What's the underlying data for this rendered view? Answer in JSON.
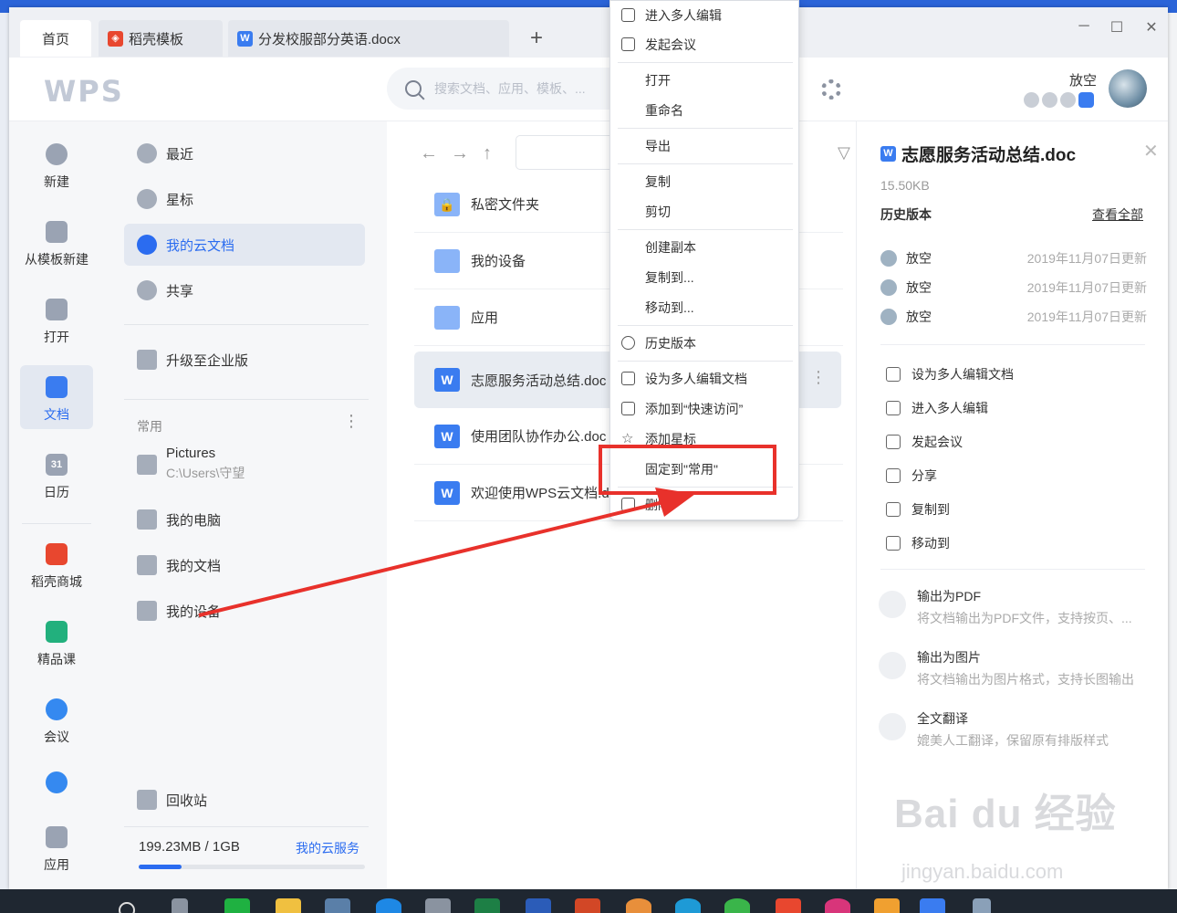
{
  "tabs": {
    "home": "首页",
    "template": "稻壳模板",
    "doc": "分发校服部分英语.docx",
    "add": "+"
  },
  "window": {
    "min": "─",
    "max": "☐",
    "close": "✕"
  },
  "header": {
    "logo": "WPS",
    "search_placeholder": "搜索文档、应用、模板、...",
    "user_name": "放空"
  },
  "rail": {
    "items": [
      {
        "label": "新建"
      },
      {
        "label": "从模板新建"
      },
      {
        "label": "打开"
      },
      {
        "label": "文档"
      },
      {
        "label": "日历"
      },
      {
        "label": "稻壳商城"
      },
      {
        "label": "精品课"
      },
      {
        "label": "会议"
      },
      {
        "label": "应用"
      }
    ],
    "calendar_day": "31"
  },
  "nav": {
    "recent": "最近",
    "star": "星标",
    "cloud": "我的云文档",
    "share": "共享",
    "upgrade": "升级至企业版",
    "common_head": "常用",
    "more": "⋮",
    "pictures_title": "Pictures",
    "pictures_path": "C:\\Users\\守望",
    "my_pc": "我的电脑",
    "my_docs": "我的文档",
    "my_device": "我的设备",
    "recycle": "回收站",
    "storage": "199.23MB / 1GB",
    "storage_link": "我的云服务",
    "storage_used": 0.19
  },
  "files": {
    "rows": [
      {
        "name": "私密文件夹"
      },
      {
        "name": "我的设备"
      },
      {
        "name": "应用"
      },
      {
        "name": "志愿服务活动总结.doc"
      },
      {
        "name": "使用团队协作办公.doc"
      },
      {
        "name": "欢迎使用WPS云文档.d"
      }
    ],
    "row_more": "⋮"
  },
  "menu": {
    "items": [
      "进入多人编辑",
      "发起会议",
      "打开",
      "重命名",
      "导出",
      "复制",
      "剪切",
      "创建副本",
      "复制到...",
      "移动到...",
      "历史版本",
      "设为多人编辑文档",
      "添加到“快速访问”",
      "添加星标",
      "固定到\"常用\"",
      "删除"
    ]
  },
  "detail": {
    "title": "志愿服务活动总结.doc",
    "size": "15.50KB",
    "history_head": "历史版本",
    "view_all": "查看全部",
    "history": [
      {
        "user": "放空",
        "date": "2019年11月07日更新"
      },
      {
        "user": "放空",
        "date": "2019年11月07日更新"
      },
      {
        "user": "放空",
        "date": "2019年11月07日更新"
      }
    ],
    "actions": [
      "设为多人编辑文档",
      "进入多人编辑",
      "发起会议",
      "分享",
      "复制到",
      "移动到"
    ],
    "features": [
      {
        "title": "输出为PDF",
        "desc": "将文档输出为PDF文件，支持按页、..."
      },
      {
        "title": "输出为图片",
        "desc": "将文档输出为图片格式，支持长图输出"
      },
      {
        "title": "全文翻译",
        "desc": "媲美人工翻译，保留原有排版样式"
      }
    ]
  },
  "watermark": {
    "main": "Bai du 经验",
    "sub": "jingyan.baidu.com"
  },
  "colors": {
    "accent": "#2b6cf0",
    "highlight": "#e8312b"
  }
}
